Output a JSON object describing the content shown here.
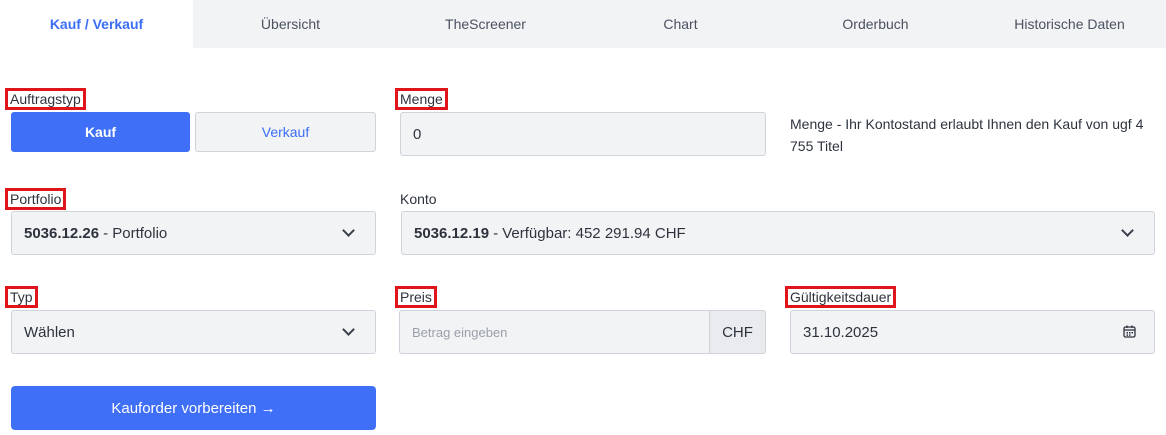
{
  "tabs": [
    {
      "label": "Kauf / Verkauf",
      "active": true
    },
    {
      "label": "Übersicht"
    },
    {
      "label": "TheScreener"
    },
    {
      "label": "Chart"
    },
    {
      "label": "Orderbuch"
    },
    {
      "label": "Historische Daten"
    }
  ],
  "order_type": {
    "label": "Auftragstyp",
    "buy_label": "Kauf",
    "sell_label": "Verkauf",
    "selected": "Kauf"
  },
  "quantity": {
    "label": "Menge",
    "value": "0",
    "info": "Menge - Ihr Kontostand erlaubt Ihnen den Kauf von ugf 4 755 Titel"
  },
  "portfolio": {
    "label": "Portfolio",
    "number": "5036.12.26",
    "name": "- Portfolio"
  },
  "account": {
    "label": "Konto",
    "number": "5036.12.19",
    "details": "- Verfügbar: 452 291.94 CHF"
  },
  "type": {
    "label": "Typ",
    "value": "Wählen"
  },
  "price": {
    "label": "Preis",
    "placeholder": "Betrag eingeben",
    "currency": "CHF"
  },
  "validity": {
    "label": "Gültigkeitsdauer",
    "value": "31.10.2025"
  },
  "submit": {
    "label": "Kauforder vorbereiten →"
  },
  "colors": {
    "accent": "#3e6ff6",
    "highlight_box": "#e0151c",
    "field_bg": "#f2f3f5"
  }
}
